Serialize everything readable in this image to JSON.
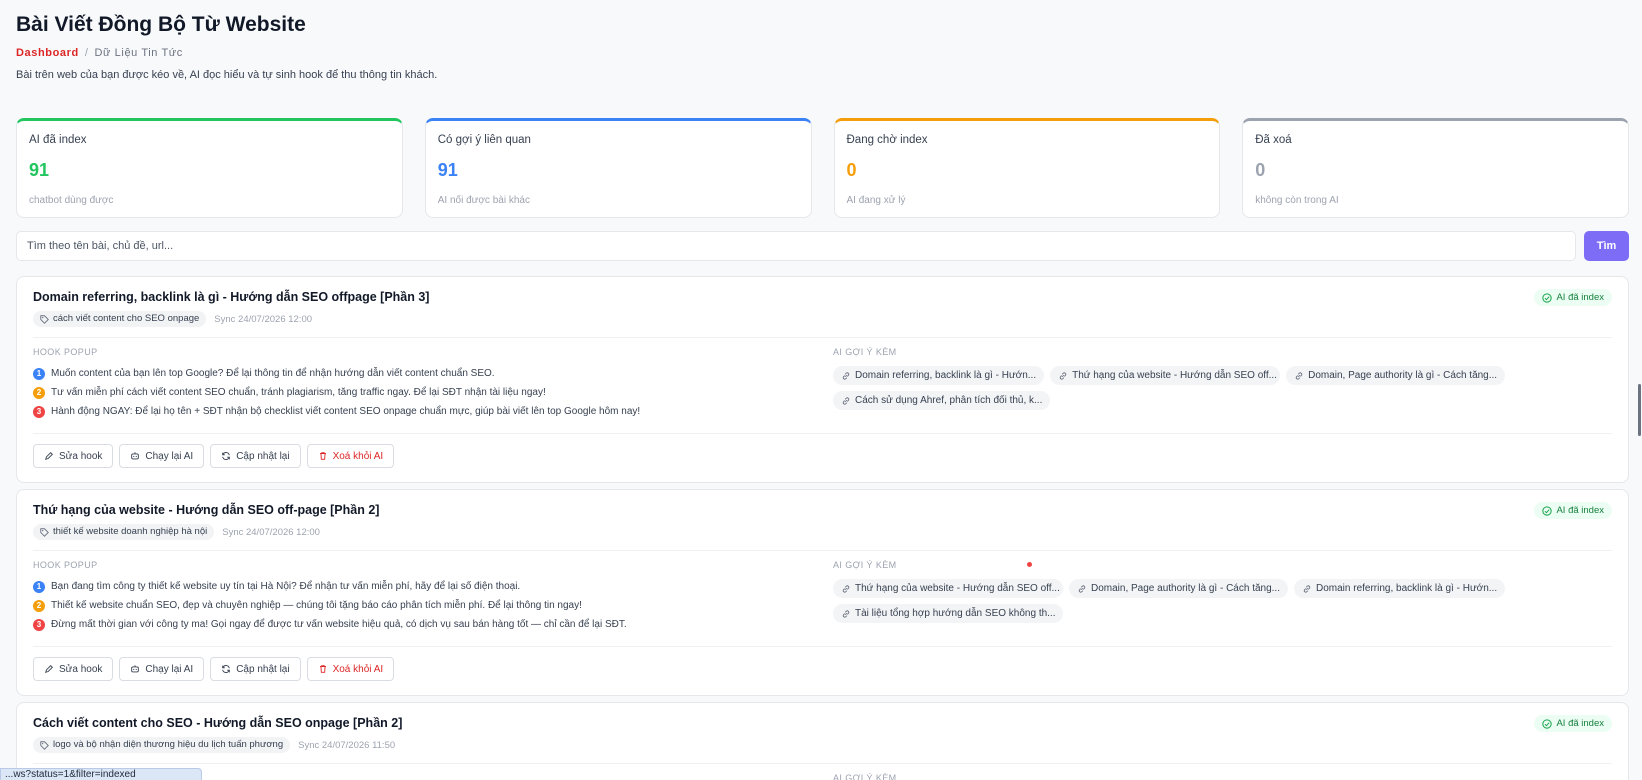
{
  "header": {
    "title": "Bài Viết Đồng Bộ Từ Website",
    "breadcrumb": {
      "root": "Dashboard",
      "separator": "/",
      "current": "Dữ Liệu Tin Tức"
    },
    "description": "Bài trên web của bạn được kéo về, AI đọc hiểu và tự sinh hook để thu thông tin khách."
  },
  "stats": [
    {
      "label": "AI đã index",
      "value": "91",
      "sub": "chatbot dùng được",
      "color": "#22c55e"
    },
    {
      "label": "Có gợi ý liên quan",
      "value": "91",
      "sub": "AI nối được bài khác",
      "color": "#3b82f6"
    },
    {
      "label": "Đang chờ index",
      "value": "0",
      "sub": "AI đang xử lý",
      "color": "#f59e0b"
    },
    {
      "label": "Đã xoá",
      "value": "0",
      "sub": "không còn trong AI",
      "color": "#9ca3af"
    }
  ],
  "search": {
    "placeholder": "Tìm theo tên bài, chủ đề, url...",
    "button_label": "Tìm"
  },
  "labels": {
    "hook_section": "HOOK POPUP",
    "suggest_section": "AI GỢI Ý KÈM"
  },
  "actions": {
    "edit": "Sửa hook",
    "rerun": "Chạy lại AI",
    "update": "Cập nhật lại",
    "remove": "Xoá khỏi AI"
  },
  "posts": [
    {
      "title": "Domain referring, backlink là gì - Hướng dẫn SEO offpage [Phần 3]",
      "tag": "cách viết content cho SEO onpage",
      "sync": "Sync 24/07/2026 12:00",
      "status": "AI đã index",
      "hooks": [
        "Muốn content của bạn lên top Google? Để lại thông tin để nhận hướng dẫn viết content chuẩn SEO.",
        "Tư vấn miễn phí cách viết content SEO chuẩn, tránh plagiarism, tăng traffic ngay. Để lại SĐT nhận tài liệu ngay!",
        "Hành động NGAY: Để lại họ tên + SĐT nhận bộ checklist viết content SEO onpage chuẩn mực, giúp bài viết lên top Google hôm nay!"
      ],
      "suggestions": [
        "Domain referring, backlink là gì - Hướn...",
        "Thứ hạng của website - Hướng dẫn SEO off...",
        "Domain, Page authority là gì - Cách tăng...",
        "Cách sử dụng Ahref, phân tích đối thủ, k..."
      ]
    },
    {
      "title": "Thứ hạng của website - Hướng dẫn SEO off-page [Phần 2]",
      "tag": "thiết kế website doanh nghiệp hà nội",
      "sync": "Sync 24/07/2026 12:00",
      "status": "AI đã index",
      "hooks": [
        "Bạn đang tìm công ty thiết kế website uy tín tại Hà Nội? Để nhận tư vấn miễn phí, hãy để lại số điện thoại.",
        "Thiết kế website chuẩn SEO, đẹp và chuyên nghiệp — chúng tôi tặng báo cáo phân tích miễn phí. Để lại thông tin ngay!",
        "Đừng mất thời gian với công ty ma! Gọi ngay để được tư vấn website hiệu quả, có dịch vụ sau bán hàng tốt — chỉ cần để lại SĐT."
      ],
      "suggestions": [
        "Thứ hạng của website - Hướng dẫn SEO off...",
        "Domain, Page authority là gì - Cách tăng...",
        "Domain referring, backlink là gì - Hướn...",
        "Tài liệu tổng hợp hướng dẫn SEO không th..."
      ]
    },
    {
      "title": "Cách viết content cho SEO - Hướng dẫn SEO onpage [Phần 2]",
      "tag": "logo và bộ nhận diện thương hiệu du lịch tuấn phương",
      "sync": "Sync 24/07/2026 11:50",
      "status": "AI đã index",
      "hooks": [],
      "suggestions": []
    }
  ],
  "status_url": "...ws?status=1&filter=indexed"
}
